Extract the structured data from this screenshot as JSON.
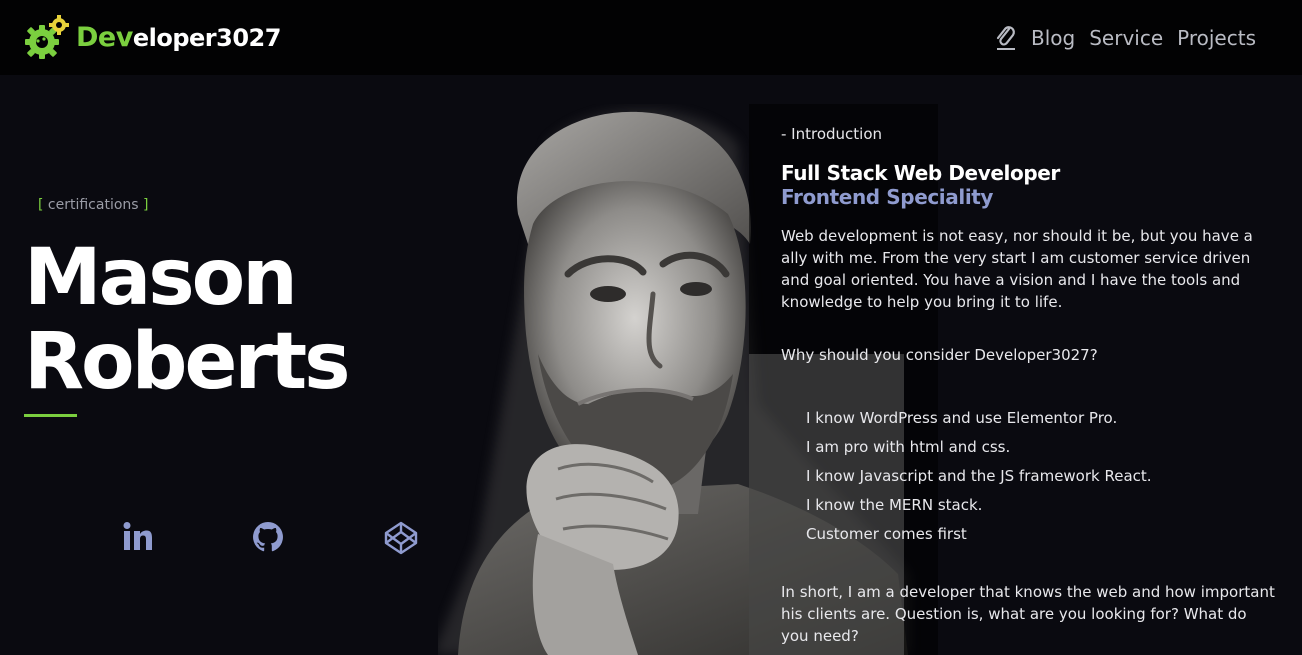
{
  "brand": {
    "name_accent": "Dev",
    "name_rest": "eloper3027",
    "logo_icon": "gear-logo-icon",
    "accent_color": "#7bcf3f"
  },
  "nav": {
    "clip_icon": "paperclip-icon",
    "links": [
      {
        "label": "Blog"
      },
      {
        "label": "Service"
      },
      {
        "label": "Projects"
      }
    ]
  },
  "hero": {
    "certifications_open": "[ ",
    "certifications_label": "certifications",
    "certifications_close": " ]",
    "first_name": "Mason",
    "last_name": "Roberts",
    "social": [
      {
        "icon": "linkedin-icon"
      },
      {
        "icon": "github-icon"
      },
      {
        "icon": "codepen-icon"
      }
    ],
    "social_color": "#8f9bcf"
  },
  "intro": {
    "label": "- Introduction",
    "headline": "Full Stack Web Developer",
    "subhead": "Frontend Speciality",
    "subhead_color": "#8f9bcf",
    "paragraph1": "Web development is not easy, nor should it be, but you have a ally with me. From the very start I am customer service driven and goal oriented. You have a vision and I have the tools and knowledge to help you bring it to life.",
    "paragraph2": "Why should you consider Developer3027?",
    "skills": [
      "I know WordPress and use Elementor Pro.",
      "I am pro with html and css.",
      "I know Javascript and the JS framework React.",
      "I know the MERN stack.",
      "Customer comes first"
    ],
    "paragraph3": "In short, I am a developer that knows the web and how important his clients are. Question is, what are you looking for? What do you need?"
  }
}
